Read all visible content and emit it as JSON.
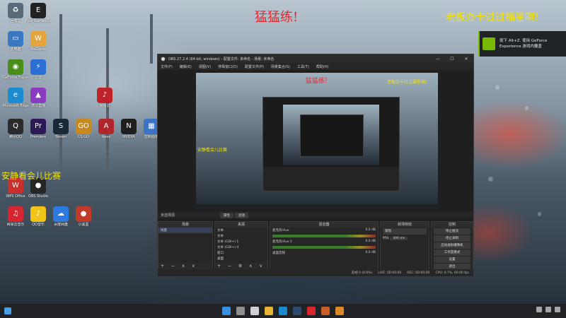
{
  "overlays": {
    "red_text": "猛猛练!",
    "yellow_text_right": "老板办卡过过福星啊!",
    "yellow_text_left": "安静看会儿比赛"
  },
  "geforce_toast": {
    "line1": "按下 Alt+Z. 使用 GeForce",
    "line2": "Experience 游戏内覆盖"
  },
  "desktop_icons": [
    {
      "label": "回收站",
      "glyph": "♻",
      "color": "#5b6a78"
    },
    {
      "label": "Epic Games Launcher",
      "glyph": "E",
      "color": "#222222"
    },
    {
      "label": "此电脑",
      "glyph": "▭",
      "color": "#3a78c2"
    },
    {
      "label": "WeGame",
      "glyph": "W",
      "color": "#e2a43b"
    },
    {
      "label": "GeForce Experience",
      "glyph": "◉",
      "color": "#4a8d19"
    },
    {
      "label": "迅雷",
      "glyph": "⚡",
      "color": "#2a6fd6"
    },
    {
      "label": "Microsoft Edge",
      "glyph": "e",
      "color": "#1b8bd0"
    },
    {
      "label": "虎牙直播",
      "glyph": "▲",
      "color": "#8a3bbf"
    },
    {
      "label": "网易云",
      "glyph": "♪",
      "color": "#c0202a"
    },
    {
      "label": "腾讯QQ",
      "glyph": "Q",
      "color": "#2b2b2b"
    },
    {
      "label": "Premiere",
      "glyph": "Pr",
      "color": "#2b1a55"
    },
    {
      "label": "Steam",
      "glyph": "S",
      "color": "#1b2838"
    },
    {
      "label": "CS:GO",
      "glyph": "GO",
      "color": "#c7891e"
    },
    {
      "label": "Apex",
      "glyph": "A",
      "color": "#b0262a"
    },
    {
      "label": "NVIDIA",
      "glyph": "N",
      "color": "#1f1f1f"
    },
    {
      "label": "控制面板",
      "glyph": "▦",
      "color": "#3b73c6"
    },
    {
      "label": "WPS Office",
      "glyph": "W",
      "color": "#c9302c"
    },
    {
      "label": "OBS Studio",
      "glyph": "●",
      "color": "#262626"
    },
    {
      "label": "网易云音乐",
      "glyph": "♫",
      "color": "#d7262f"
    },
    {
      "label": "QQ音乐",
      "glyph": "♪",
      "color": "#f2c418"
    },
    {
      "label": "百度网盘",
      "glyph": "☁",
      "color": "#2f7ae0"
    },
    {
      "label": "小黑盒",
      "glyph": "●",
      "color": "#c23a2a"
    }
  ],
  "obs": {
    "title": "OBS 27.2.4 (64-bit, windows) - 配置文件: 未命名 - 场景: 未命名",
    "menu": [
      "文件(F)",
      "编辑(E)",
      "视图(V)",
      "停靠窗口(D)",
      "配置文件(P)",
      "场景集合(S)",
      "工具(T)",
      "帮助(H)"
    ],
    "status_label": "未选择源",
    "tab_properties": "属性",
    "tab_filters": "滤镜",
    "scenes_header": "场景",
    "scene_item": "场景",
    "sources_header": "来源",
    "sources": [
      "文本",
      "文本",
      "文本 (GDI+) 1",
      "文本 (GDI+) 4",
      "窗口",
      "桌面"
    ],
    "mixer_header": "混音器",
    "mixer_tracks": [
      {
        "name": "麦克风/Aux",
        "db": "0.0 dB"
      },
      {
        "name": "麦克风/Aux 2",
        "db": "0.0 dB"
      },
      {
        "name": "桌面音频",
        "db": "0.0 dB"
      }
    ],
    "transitions_header": "转场特效",
    "transition_value": "渐隐",
    "duration_label": "时长",
    "duration_value": "300 ms",
    "controls_header": "控制",
    "controls": [
      "停止推流",
      "停止录制",
      "启动虚拟摄像机",
      "工作室模式",
      "设置",
      "退出"
    ],
    "status_bar": {
      "dropped": "丢帧 0 (0.0%)",
      "live": "LIVE: 00:00:00",
      "rec": "REC: 00:00:00",
      "cpu": "CPU: 0.7%, 60.00 fps"
    },
    "preview_inner": {
      "red_text": "猛猛练!",
      "yellow_text": "老板办卡过过福星啊!",
      "yellow_left": "安静看会儿比赛"
    }
  },
  "taskbar_icons": [
    {
      "name": "start",
      "color": "#3c8fe0"
    },
    {
      "name": "search",
      "color": "#8f8f8f"
    },
    {
      "name": "task-view",
      "color": "#d0d0d0"
    },
    {
      "name": "explorer",
      "color": "#e5b735"
    },
    {
      "name": "edge",
      "color": "#1b8bd0"
    },
    {
      "name": "steam",
      "color": "#2d4b6d"
    },
    {
      "name": "netease",
      "color": "#d7262f"
    },
    {
      "name": "obs",
      "color": "#c95d27"
    },
    {
      "name": "wps",
      "color": "#dd8a2a"
    }
  ]
}
